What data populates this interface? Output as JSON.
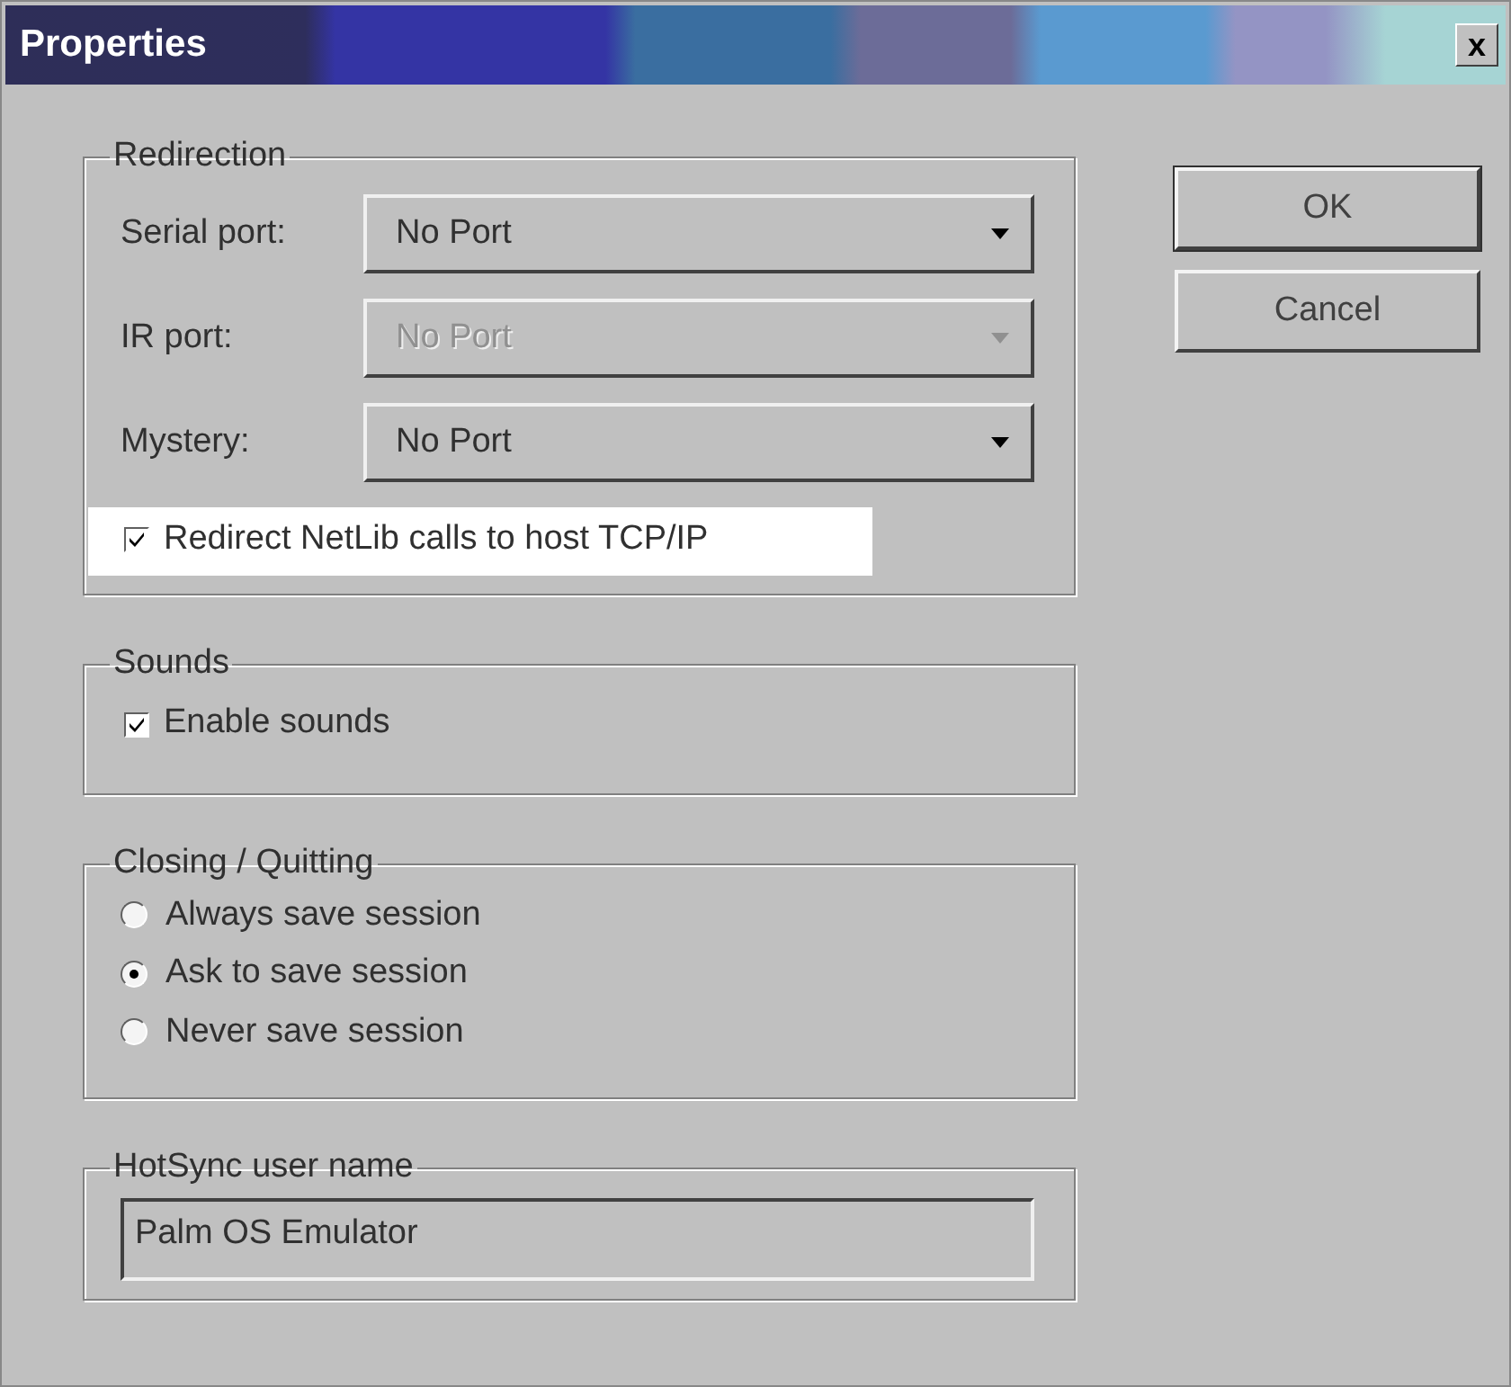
{
  "window": {
    "title": "Properties",
    "close": "x"
  },
  "groups": [
    {
      "kind": "dropdowns",
      "title": "Redirection",
      "rows": [
        {
          "label": "Serial port:",
          "value": "No Port",
          "disabled": false
        },
        {
          "label": "IR port:",
          "value": "No Port",
          "disabled": true
        },
        {
          "label": "Mystery:",
          "value": "No Port",
          "disabled": false
        }
      ],
      "checkboxes": [
        {
          "label": "Redirect NetLib calls to host TCP/IP",
          "checked": true,
          "highlighted": true
        }
      ]
    },
    {
      "kind": "checkboxes",
      "title": "Sounds",
      "checkboxes": [
        {
          "label": "Enable sounds",
          "checked": true,
          "highlighted": false
        }
      ]
    },
    {
      "kind": "radios",
      "title": "Closing / Quitting",
      "options": [
        {
          "label": "Always save session",
          "selected": false
        },
        {
          "label": "Ask to save session",
          "selected": true
        },
        {
          "label": "Never save session",
          "selected": false
        }
      ]
    },
    {
      "kind": "text",
      "title": "HotSync user name",
      "value": "Palm OS Emulator"
    }
  ],
  "buttons": [
    "OK",
    "Cancel"
  ]
}
